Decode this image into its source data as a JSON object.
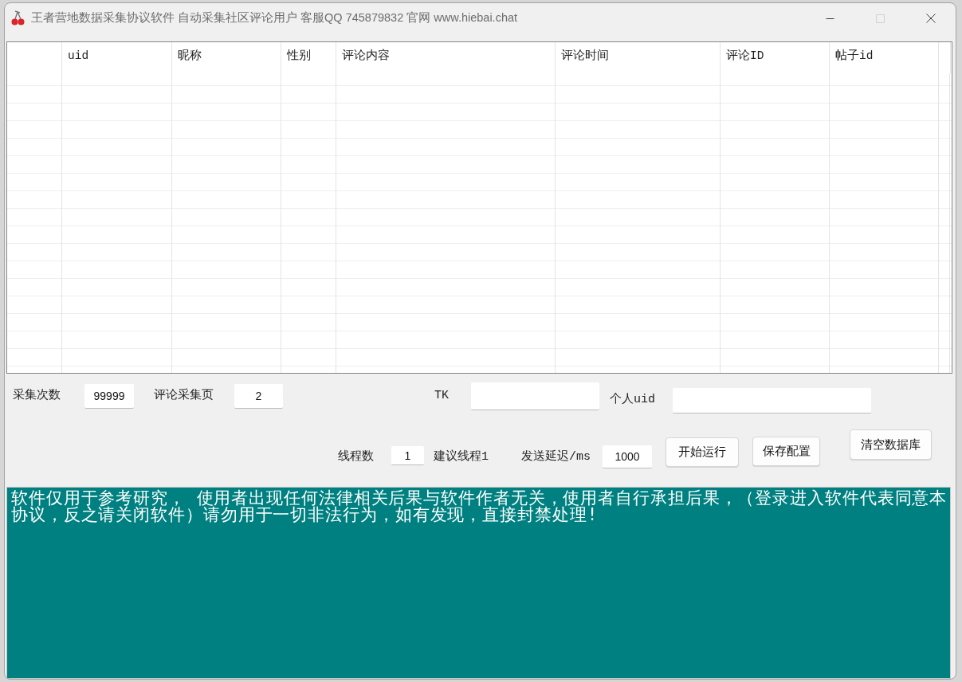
{
  "window": {
    "title": "王者营地数据采集协议软件 自动采集社区评论用户 客服QQ 745879832 官网 www.hiebai.chat"
  },
  "window_controls": [
    {
      "kind": "minimize",
      "disabled": false
    },
    {
      "kind": "maximize",
      "disabled": true
    },
    {
      "kind": "close",
      "disabled": false
    }
  ],
  "table": {
    "columns": [
      "uid",
      "昵称",
      "性别",
      "评论内容",
      "评论时间",
      "评论ID",
      "帖子id"
    ]
  },
  "form_rows": [
    {
      "items": [
        {
          "kind": "label",
          "text": "采集次数"
        },
        {
          "kind": "field",
          "value": "99999"
        },
        {
          "kind": "label",
          "text": "评论采集页"
        },
        {
          "kind": "field",
          "value": "2"
        },
        {
          "kind": "label",
          "text": "TK"
        },
        {
          "kind": "field"
        },
        {
          "kind": "label",
          "text": "个人uid"
        },
        {
          "kind": "field"
        }
      ]
    },
    {
      "items": [
        {
          "kind": "label",
          "text": "线程数"
        },
        {
          "kind": "field",
          "value": "1"
        },
        {
          "kind": "label",
          "text": "建议线程1"
        },
        {
          "kind": "label",
          "text": "发送延迟/ms"
        },
        {
          "kind": "field",
          "value": "1000"
        },
        {
          "kind": "button",
          "label": "开始运行"
        },
        {
          "kind": "button",
          "label": "保存配置"
        },
        {
          "kind": "button",
          "label": "清空数据库"
        }
      ]
    }
  ],
  "notice": {
    "text": "软件仅用于参考研究， 使用者出现任何法律相关后果与软件作者无关，使用者自行承担后果，（登录进入软件代表同意本协议，反之请关闭软件）请勿用于一切非法行为，如有发现，直接封禁处理!"
  }
}
